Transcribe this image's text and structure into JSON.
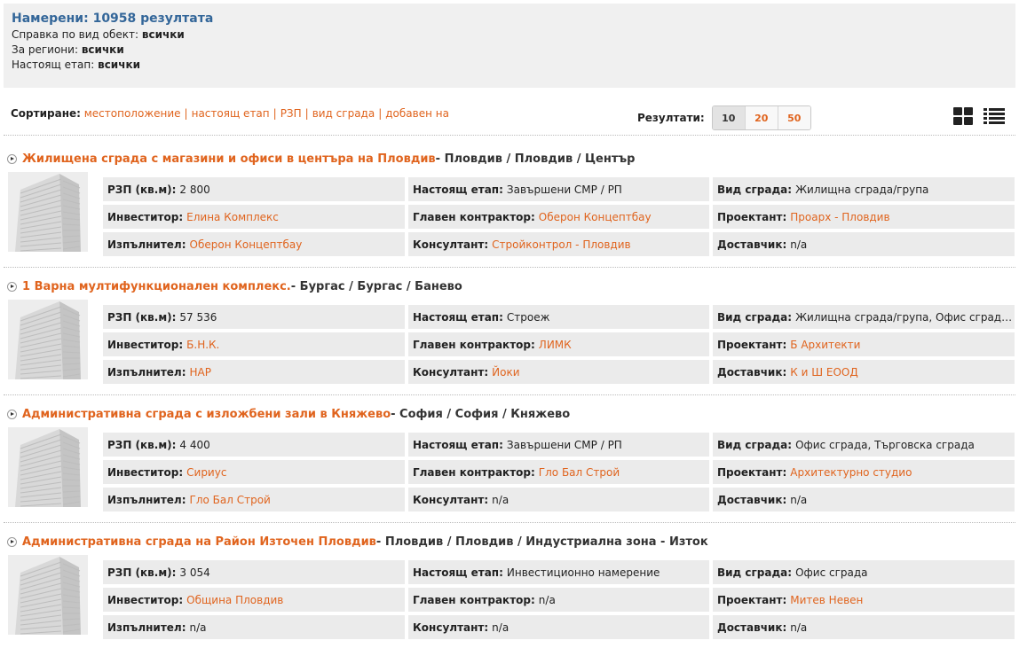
{
  "summary": {
    "title": "Намерени: 10958 резултата",
    "lines": [
      {
        "label": "Справка по вид обект:",
        "value": "всички"
      },
      {
        "label": "За региони:",
        "value": "всички"
      },
      {
        "label": "Настоящ етап:",
        "value": "всички"
      }
    ]
  },
  "sort": {
    "label": "Сортиране:",
    "options": [
      "местоположение",
      "настоящ етап",
      "РЗП",
      "вид сграда",
      "добавен на"
    ]
  },
  "results": {
    "label": "Резултати:",
    "options": [
      "10",
      "20",
      "50"
    ],
    "selected": "10"
  },
  "icons": {
    "grid": "grid-view-icon",
    "list": "list-view-icon",
    "bullet": "play-bullet-icon",
    "thumb": "building-icon"
  },
  "colors": {
    "accent": "#e0641e",
    "title": "#336699",
    "cell_bg": "#ebebeb"
  },
  "records": [
    {
      "name": "Жилищена сграда с магазини и офиси в центъра на Пловдив",
      "location": " - Пловдив / Пловдив / Център",
      "fields": [
        {
          "k": "РЗП (кв.м):",
          "v": "2 800",
          "link": false
        },
        {
          "k": "Настоящ етап:",
          "v": "Завършени СМР / РП",
          "link": false
        },
        {
          "k": "Вид сграда:",
          "v": "Жилищна сграда/група",
          "link": false
        },
        {
          "k": "Инвеститор:",
          "v": "Елина Комплекс",
          "link": true
        },
        {
          "k": "Главен контрактор:",
          "v": "Оберон Концептбау",
          "link": true
        },
        {
          "k": "Проектант:",
          "v": "Проарх - Пловдив",
          "link": true
        },
        {
          "k": "Изпълнител:",
          "v": "Оберон Концептбау",
          "link": true
        },
        {
          "k": "Консултант:",
          "v": "Стройконтрол - Пловдив",
          "link": true
        },
        {
          "k": "Доставчик:",
          "v": "n/a",
          "link": false
        }
      ]
    },
    {
      "name": "1 Варна мултифункционален комплекс.",
      "location": " - Бургас / Бургас / Банево",
      "fields": [
        {
          "k": "РЗП (кв.м):",
          "v": "57 536",
          "link": false
        },
        {
          "k": "Настоящ етап:",
          "v": "Строеж",
          "link": false
        },
        {
          "k": "Вид сграда:",
          "v": "Жилищна сграда/група, Офис сград…",
          "link": false
        },
        {
          "k": "Инвеститор:",
          "v": "Б.Н.К.",
          "link": true
        },
        {
          "k": "Главен контрактор:",
          "v": "ЛИМК",
          "link": true
        },
        {
          "k": "Проектант:",
          "v": "Б Архитекти",
          "link": true
        },
        {
          "k": "Изпълнител:",
          "v": "НАР",
          "link": true
        },
        {
          "k": "Консултант:",
          "v": "Йоки",
          "link": true
        },
        {
          "k": "Доставчик:",
          "v": "К и Ш ЕООД",
          "link": true
        }
      ]
    },
    {
      "name": "Административна сграда с изложбени зали в Княжево",
      "location": " - София / София / Княжево",
      "fields": [
        {
          "k": "РЗП (кв.м):",
          "v": "4 400",
          "link": false
        },
        {
          "k": "Настоящ етап:",
          "v": "Завършени СМР / РП",
          "link": false
        },
        {
          "k": "Вид сграда:",
          "v": "Офис сграда, Търговска сграда",
          "link": false
        },
        {
          "k": "Инвеститор:",
          "v": "Сириус",
          "link": true
        },
        {
          "k": "Главен контрактор:",
          "v": "Гло Бал Строй",
          "link": true
        },
        {
          "k": "Проектант:",
          "v": "Архитектурно студио",
          "link": true
        },
        {
          "k": "Изпълнител:",
          "v": "Гло Бал Строй",
          "link": true
        },
        {
          "k": "Консултант:",
          "v": "n/a",
          "link": false
        },
        {
          "k": "Доставчик:",
          "v": "n/a",
          "link": false
        }
      ]
    },
    {
      "name": "Административна сграда на Район Източен Пловдив",
      "location": " - Пловдив / Пловдив / Индустриална зона - Изток",
      "fields": [
        {
          "k": "РЗП (кв.м):",
          "v": "3 054",
          "link": false
        },
        {
          "k": "Настоящ етап:",
          "v": "Инвестиционно намерение",
          "link": false
        },
        {
          "k": "Вид сграда:",
          "v": "Офис сграда",
          "link": false
        },
        {
          "k": "Инвеститор:",
          "v": "Община Пловдив",
          "link": true
        },
        {
          "k": "Главен контрактор:",
          "v": "n/a",
          "link": false
        },
        {
          "k": "Проектант:",
          "v": "Митев Невен",
          "link": true
        },
        {
          "k": "Изпълнител:",
          "v": "n/a",
          "link": false
        },
        {
          "k": "Консултант:",
          "v": "n/a",
          "link": false
        },
        {
          "k": "Доставчик:",
          "v": "n/a",
          "link": false
        }
      ]
    }
  ]
}
